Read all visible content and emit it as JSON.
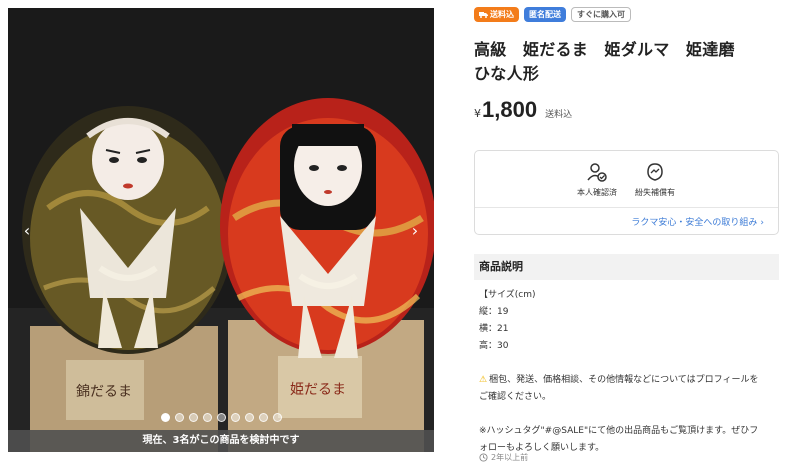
{
  "gallery": {
    "viewer_text": "現在、3名がこの商品を検討中です",
    "dot_count": 9,
    "active_index": 0,
    "prev_arrow": "‹",
    "next_arrow": "›"
  },
  "badges": [
    {
      "label": "送料込",
      "style": "orange",
      "icon": "truck-icon"
    },
    {
      "label": "匿名配送",
      "style": "blue",
      "icon": ""
    },
    {
      "label": "すぐに購入可",
      "style": "outline",
      "icon": ""
    }
  ],
  "product": {
    "title_line1": "高級　姫だるま　姫ダルマ　姫達磨",
    "title_line2": "ひな人形",
    "currency": "¥",
    "price": "1,800",
    "shipping": "送料込"
  },
  "safety": {
    "feature1": "本人確認済",
    "feature2": "紛失補償有",
    "link": "ラクマ安心・安全への取り組み"
  },
  "description": {
    "header": "商品説明",
    "size_title": "【サイズ(cm)",
    "height": "縦：19",
    "width": "横：21",
    "depth": "高：30",
    "notice_line1": "梱包、発送、価格相談、その他情報などについてはプロフィールを",
    "notice_line2": "ご確認ください。",
    "hashtag_line1": "※ハッシュタグ\"#@SALE\"にて他の出品商品もご覧頂けます。ぜひフ",
    "hashtag_line2": "ォローもよろしく願いします。"
  },
  "posted": "2年以上前",
  "colors": {
    "accent_orange": "#f37c1a",
    "accent_blue": "#3f7ddb",
    "link_blue": "#3c7bd6"
  }
}
